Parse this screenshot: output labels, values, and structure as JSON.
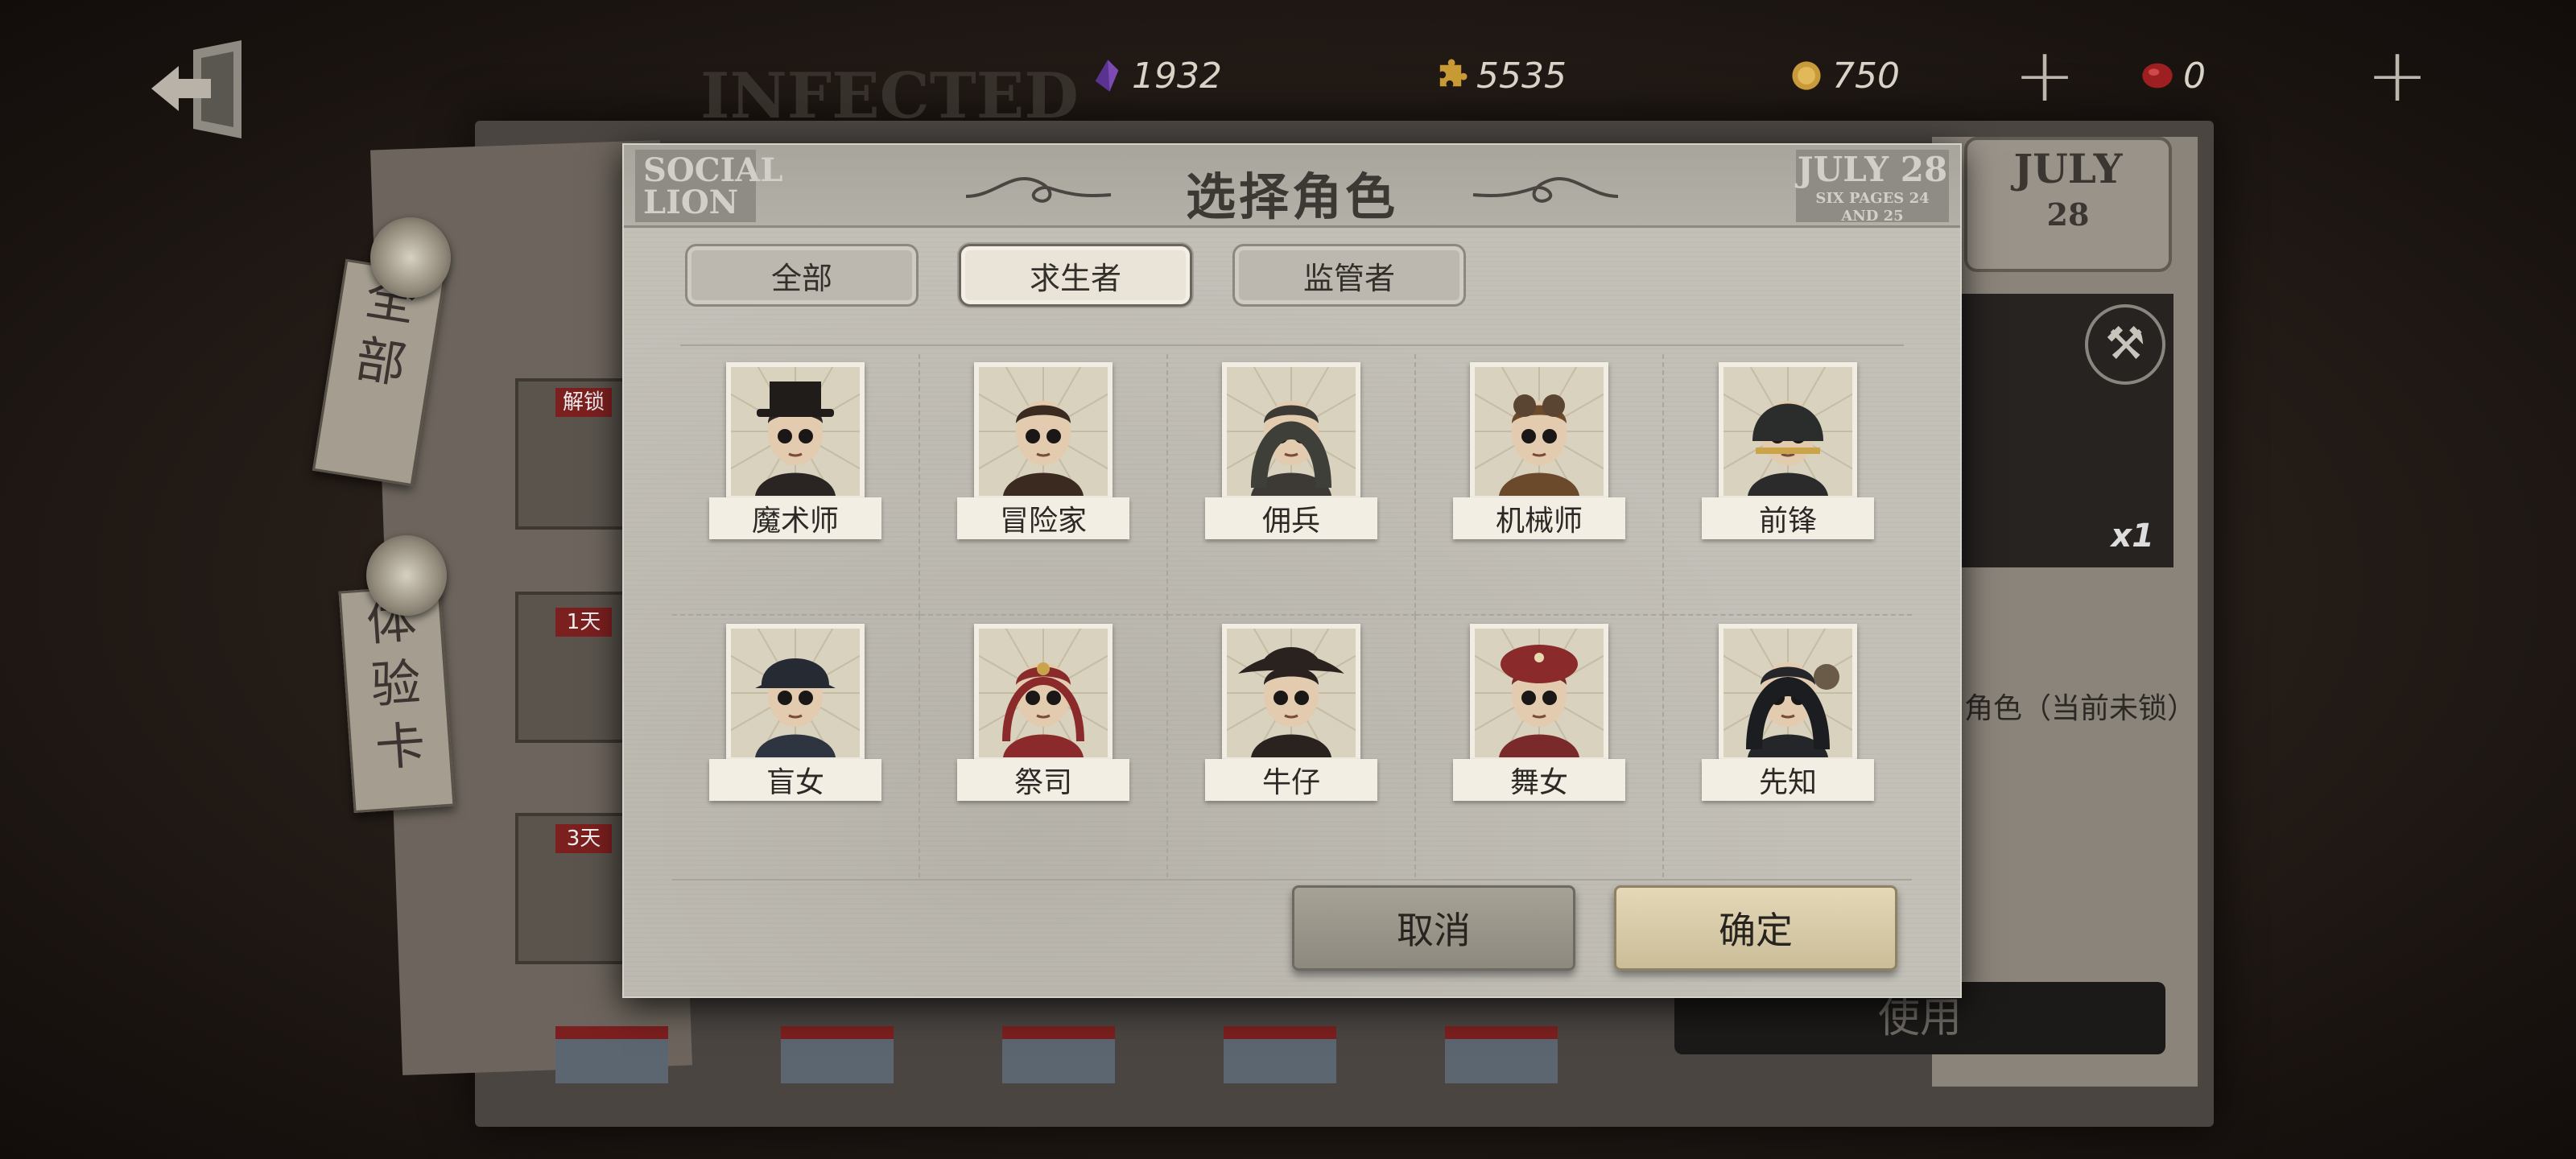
{
  "background": {
    "newspaper_headline": "INFECTED",
    "right_date_month": "JULY",
    "right_date_day": "28",
    "side_tag_1": "全部",
    "side_tag_2": "体验卡",
    "card_ribbons": [
      "解锁",
      "1天",
      "3天"
    ],
    "item_count": "x1",
    "side_text": "角色（当前未锁）",
    "use_button_label": "使用"
  },
  "currency": {
    "crystal": "1932",
    "clue": "5535",
    "fragment": "750",
    "echo": "0"
  },
  "modal": {
    "title": "选择角色",
    "header_left": "SOCIAL LION",
    "header_right_month": "JULY",
    "header_right_day": "28",
    "header_right_sub": "SIX PAGES 24 AND 25",
    "tabs": [
      {
        "label": "全部",
        "active": false
      },
      {
        "label": "求生者",
        "active": true
      },
      {
        "label": "监管者",
        "active": false
      }
    ],
    "characters": [
      {
        "name": "魔术师",
        "icon": "magician-portrait"
      },
      {
        "name": "冒险家",
        "icon": "explorer-portrait"
      },
      {
        "name": "佣兵",
        "icon": "mercenary-portrait"
      },
      {
        "name": "机械师",
        "icon": "mechanic-portrait"
      },
      {
        "name": "前锋",
        "icon": "forward-portrait"
      },
      {
        "name": "盲女",
        "icon": "blind-girl-portrait"
      },
      {
        "name": "祭司",
        "icon": "priestess-portrait"
      },
      {
        "name": "牛仔",
        "icon": "cowboy-portrait"
      },
      {
        "name": "舞女",
        "icon": "dancer-portrait"
      },
      {
        "name": "先知",
        "icon": "seer-portrait"
      }
    ],
    "cancel_label": "取消",
    "confirm_label": "确定"
  },
  "colors": {
    "modal_bg": "#c3c0b8",
    "tab_active": "#e9e4d7",
    "confirm_button": "#d8caa6",
    "cancel_button": "#9a968b"
  }
}
